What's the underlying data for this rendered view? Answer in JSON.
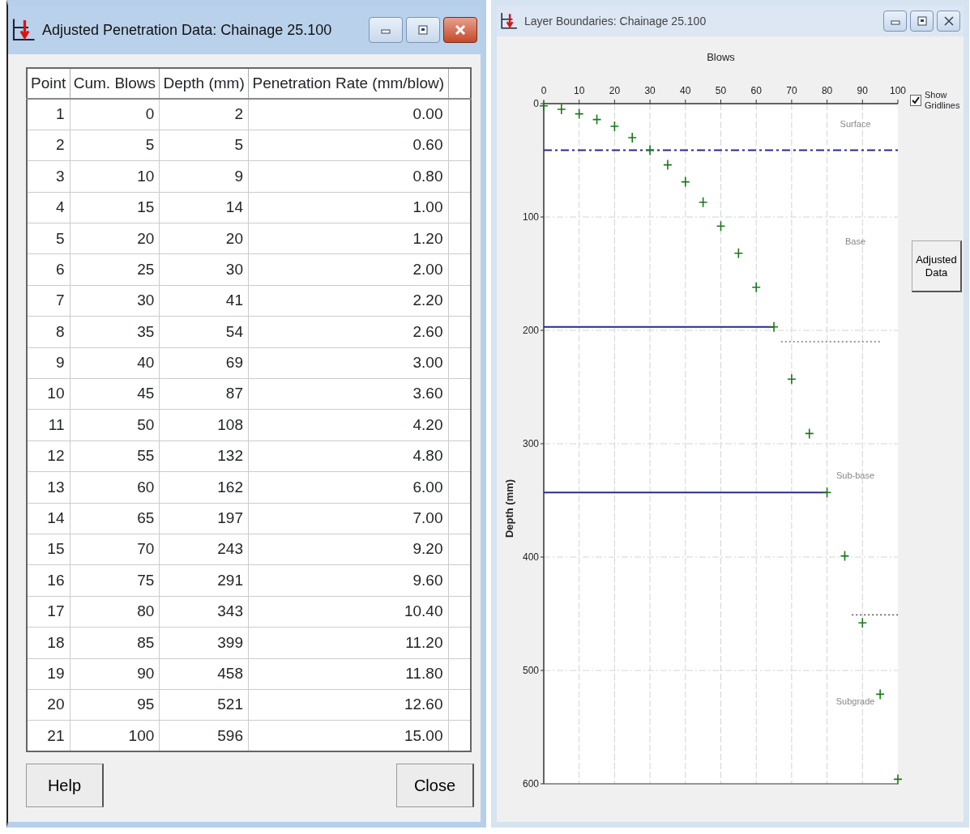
{
  "windows": [
    {
      "kind": "table",
      "title": "Adjusted Penetration Data: Chainage 25.100",
      "active": true,
      "table": {
        "columns": [
          "Point",
          "Cum. Blows",
          "Depth (mm)",
          "Penetration Rate (mm/blow)"
        ],
        "rows": [
          [
            "1",
            "0",
            "2",
            "0.00"
          ],
          [
            "2",
            "5",
            "5",
            "0.60"
          ],
          [
            "3",
            "10",
            "9",
            "0.80"
          ],
          [
            "4",
            "15",
            "14",
            "1.00"
          ],
          [
            "5",
            "20",
            "20",
            "1.20"
          ],
          [
            "6",
            "25",
            "30",
            "2.00"
          ],
          [
            "7",
            "30",
            "41",
            "2.20"
          ],
          [
            "8",
            "35",
            "54",
            "2.60"
          ],
          [
            "9",
            "40",
            "69",
            "3.00"
          ],
          [
            "10",
            "45",
            "87",
            "3.60"
          ],
          [
            "11",
            "50",
            "108",
            "4.20"
          ],
          [
            "12",
            "55",
            "132",
            "4.80"
          ],
          [
            "13",
            "60",
            "162",
            "6.00"
          ],
          [
            "14",
            "65",
            "197",
            "7.00"
          ],
          [
            "15",
            "70",
            "243",
            "9.20"
          ],
          [
            "16",
            "75",
            "291",
            "9.60"
          ],
          [
            "17",
            "80",
            "343",
            "10.40"
          ],
          [
            "18",
            "85",
            "399",
            "11.20"
          ],
          [
            "19",
            "90",
            "458",
            "11.80"
          ],
          [
            "20",
            "95",
            "521",
            "12.60"
          ],
          [
            "21",
            "100",
            "596",
            "15.00"
          ]
        ]
      },
      "buttons": [
        "Help",
        "Close"
      ]
    },
    {
      "kind": "chart",
      "title": "Layer Boundaries: Chainage 25.100",
      "active": false,
      "show_gridlines": {
        "label": "Show Gridlines",
        "checked": true
      },
      "side_button": "Adjusted Data",
      "chart_data": {
        "type": "scatter",
        "xlabel": "Blows",
        "ylabel": "Depth (mm)",
        "x": [
          0,
          5,
          10,
          15,
          20,
          25,
          30,
          35,
          40,
          45,
          50,
          55,
          60,
          65,
          70,
          75,
          80,
          85,
          90,
          95,
          100
        ],
        "series": [
          {
            "color": "#1a7a1a",
            "values": [
              2,
              5,
              9,
              14,
              20,
              30,
              41,
              54,
              69,
              87,
              108,
              132,
              162,
              197,
              243,
              291,
              343,
              399,
              458,
              521,
              596
            ]
          }
        ],
        "xlim": [
          0,
          100
        ],
        "ylim": [
          600,
          0
        ],
        "grid": true,
        "xticks": [
          0,
          10,
          20,
          30,
          40,
          50,
          60,
          70,
          80,
          90,
          100
        ],
        "yticks": [
          0,
          100,
          200,
          300,
          400,
          500,
          600
        ],
        "ref_lines": [
          {
            "axis": "y",
            "value": 41
          },
          {
            "axis": "y",
            "value": 197
          },
          {
            "axis": "y",
            "value": 210
          },
          {
            "axis": "y",
            "value": 343
          },
          {
            "axis": "y",
            "value": 451
          }
        ],
        "annotations": [
          "Surface",
          "Base",
          "Sub-base",
          "Subgrade"
        ]
      }
    }
  ]
}
